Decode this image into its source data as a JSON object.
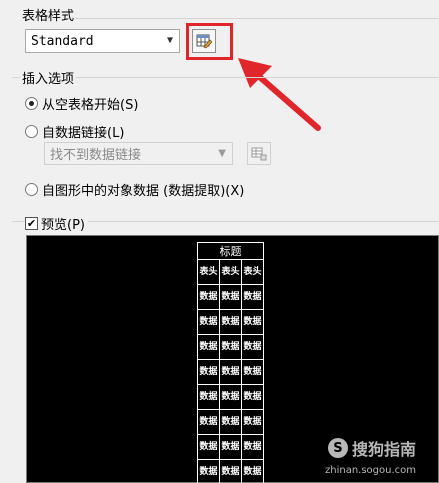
{
  "table_style": {
    "label": "表格样式",
    "selected": "Standard",
    "launch_button_icon": "table-style-edit-icon",
    "highlight_color": "#e0262b"
  },
  "insert_options": {
    "label": "插入选项",
    "options": [
      {
        "label": "从空表格开始(S)",
        "selected": true
      },
      {
        "label": "自数据链接(L)",
        "selected": false
      },
      {
        "label": "自图形中的对象数据 (数据提取)(X)",
        "selected": false
      }
    ],
    "data_link_combo": "找不到数据链接",
    "data_link_button_icon": "data-link-manager-icon"
  },
  "preview": {
    "label": "预览(P)",
    "checked": true,
    "table_title": "标题",
    "header_cells": [
      "表头",
      "表头",
      "表头"
    ],
    "data_cell": "数据",
    "data_row_count": 8
  },
  "watermark": {
    "brand": "搜狗指南",
    "url": "zhinan.sogou.com"
  },
  "arrow_color": "#e0262b"
}
